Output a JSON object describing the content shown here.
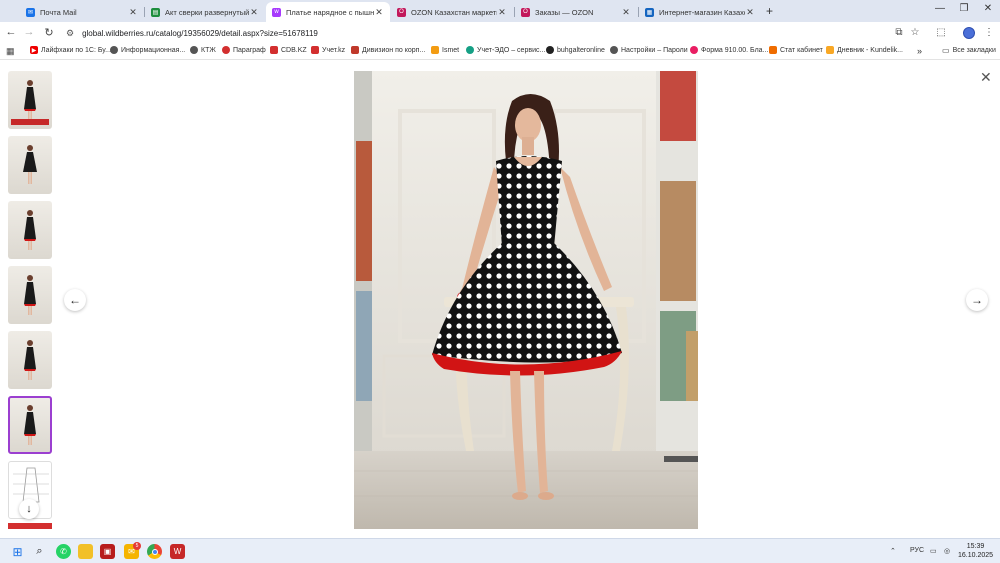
{
  "tabs": [
    {
      "title": "Почта Mail",
      "icon": "mail-icon",
      "color": "#1a73e8",
      "active": false
    },
    {
      "title": "Акт сверки развернутый № 0",
      "icon": "doc-icon",
      "color": "#1e8e3e",
      "active": false
    },
    {
      "title": "Платье нарядное с пышной ю",
      "icon": "wildberries-icon",
      "color": "#a73afd",
      "active": true
    },
    {
      "title": "OZON Казахстан маркетплейс",
      "icon": "ozon-icon",
      "color": "#c2185b",
      "active": false
    },
    {
      "title": "Заказы — OZON",
      "icon": "ozon-icon",
      "color": "#c2185b",
      "active": false
    },
    {
      "title": "Интернет-магазин Казахста",
      "icon": "store-icon",
      "color": "#1565c0",
      "active": false
    }
  ],
  "window": {
    "minimize": "—",
    "maximize": "❐",
    "close": "✕",
    "new_tab": "+"
  },
  "address": {
    "url": "global.wildberries.ru/catalog/19356029/detail.aspx?size=51678119"
  },
  "bookmarks": [
    {
      "label": "Лайфхаки по 1С: Бу...",
      "icon": "youtube-icon",
      "color": "#e00"
    },
    {
      "label": "Информационная...",
      "icon": "globe-icon",
      "color": "#555"
    },
    {
      "label": "КТЖ",
      "icon": "globe-icon",
      "color": "#555"
    },
    {
      "label": "Параграф",
      "icon": "paragraf-icon",
      "color": "#d32f2f"
    },
    {
      "label": "CDB.KZ",
      "icon": "cdb-icon",
      "color": "#d32f2f"
    },
    {
      "label": "Учет.kz",
      "icon": "uchet-icon",
      "color": "#d32f2f"
    },
    {
      "label": "Дивизион по корп...",
      "icon": "email-icon",
      "color": "#c0392b"
    },
    {
      "label": "Ismet",
      "icon": "ismet-icon",
      "color": "#f39c12"
    },
    {
      "label": "Учет-ЭДО – сервис...",
      "icon": "edo-icon",
      "color": "#16a085"
    },
    {
      "label": "buhgalteronline",
      "icon": "buh-icon",
      "color": "#222"
    },
    {
      "label": "Настройки – Пароли",
      "icon": "gear-icon",
      "color": "#555"
    },
    {
      "label": "Форма 910.00. Бла...",
      "icon": "form-icon",
      "color": "#e91e63"
    },
    {
      "label": "Стат кабинет",
      "icon": "stat-icon",
      "color": "#ef6c00"
    },
    {
      "label": "Дневник - Kundelik...",
      "icon": "kundelik-icon",
      "color": "#f9a825"
    }
  ],
  "bookmarks_all": "Все закладки",
  "viewer": {
    "thumbnails": 8,
    "selected_thumbnail": 6
  },
  "taskbar": {
    "lang": "РУС",
    "time": "15:39",
    "date": "16.10.2025",
    "badge": "5"
  }
}
